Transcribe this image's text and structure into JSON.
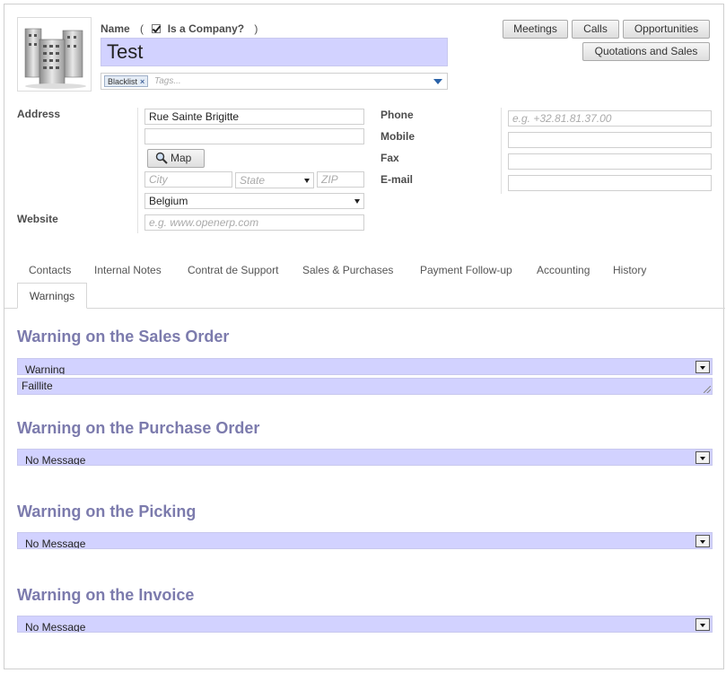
{
  "header": {
    "name_label": "Name",
    "open_paren": "(",
    "is_company_label": "Is a Company?",
    "close_paren": ")",
    "name_value": "Test",
    "tag_label": "Blacklist",
    "tag_remove": "×",
    "tags_placeholder": "Tags...",
    "is_company_checked": true
  },
  "buttons": {
    "meetings": "Meetings",
    "calls": "Calls",
    "opportunities": "Opportunities",
    "quotations": "Quotations and Sales"
  },
  "address": {
    "label": "Address",
    "street": "Rue Sainte Brigitte",
    "street2": "",
    "map_button": "Map",
    "city_placeholder": "City",
    "state_placeholder": "State",
    "zip_placeholder": "ZIP",
    "country": "Belgium",
    "website_label": "Website",
    "website_placeholder": "e.g. www.openerp.com"
  },
  "contact": {
    "phone_label": "Phone",
    "phone_placeholder": "e.g. +32.81.81.37.00",
    "mobile_label": "Mobile",
    "fax_label": "Fax",
    "email_label": "E-mail"
  },
  "tabs": [
    "Contacts",
    "Internal Notes",
    "Contrat de Support",
    "Sales & Purchases",
    "Payment Follow-up",
    "Accounting",
    "History",
    "Warnings"
  ],
  "active_tab": "Warnings",
  "warnings": {
    "sales_title": "Warning on the Sales Order",
    "sales_value": "Warning",
    "sales_message": "Faillite",
    "purchase_title": "Warning on the Purchase Order",
    "purchase_value": "No Message",
    "picking_title": "Warning on the Picking",
    "picking_value": "No Message",
    "invoice_title": "Warning on the Invoice",
    "invoice_value": "No Message"
  },
  "colors": {
    "required_field_bg": "#d2d2ff",
    "section_title": "#7c7bad",
    "link_blue": "#2a62a8"
  }
}
